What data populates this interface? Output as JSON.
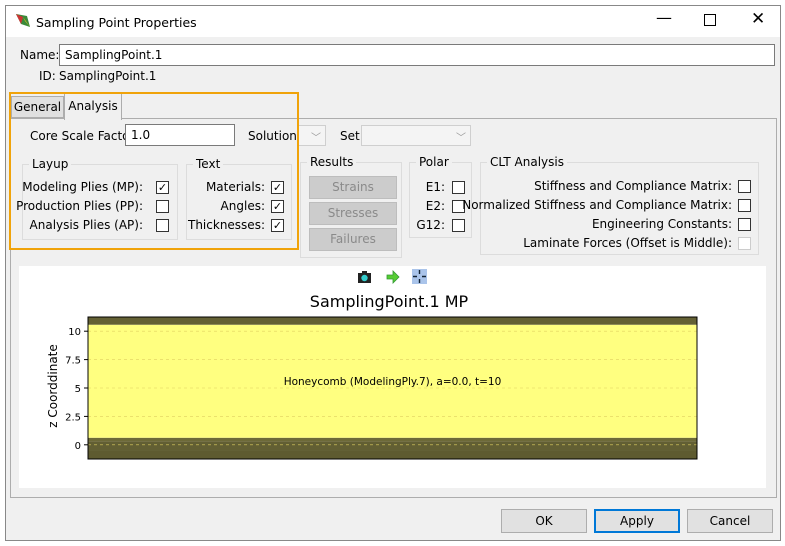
{
  "window": {
    "title": "Sampling Point Properties",
    "controls": [
      "minimize",
      "maximize",
      "close"
    ]
  },
  "name": {
    "label": "Name:",
    "value": "SamplingPoint.1"
  },
  "id": {
    "label": "ID:",
    "value": "SamplingPoint.1"
  },
  "tabs": [
    {
      "label": "General",
      "active": false
    },
    {
      "label": "Analysis",
      "active": true
    }
  ],
  "analysis": {
    "core_scale_factor": {
      "label": "Core Scale Factor:",
      "value": "1.0"
    },
    "solution": {
      "label": "Solution:",
      "value": ""
    },
    "set": {
      "label": "Set:",
      "value": ""
    },
    "layup": {
      "title": "Layup",
      "items": [
        {
          "label": "Modeling Plies (MP):",
          "checked": true
        },
        {
          "label": "Production Plies (PP):",
          "checked": false
        },
        {
          "label": "Analysis Plies (AP):",
          "checked": false
        }
      ]
    },
    "text": {
      "title": "Text",
      "items": [
        {
          "label": "Materials:",
          "checked": true
        },
        {
          "label": "Angles:",
          "checked": true
        },
        {
          "label": "Thicknesses:",
          "checked": true
        }
      ]
    },
    "results": {
      "title": "Results",
      "buttons": [
        "Strains",
        "Stresses",
        "Failures"
      ]
    },
    "polar": {
      "title": "Polar",
      "items": [
        {
          "label": "E1:",
          "checked": false
        },
        {
          "label": "E2:",
          "checked": false
        },
        {
          "label": "G12:",
          "checked": false
        }
      ]
    },
    "clt": {
      "title": "CLT Analysis",
      "items": [
        {
          "label": "Stiffness and Compliance Matrix:",
          "checked": false,
          "enabled": true
        },
        {
          "label": "Normalized Stiffness and Compliance Matrix:",
          "checked": false,
          "enabled": true
        },
        {
          "label": "Engineering Constants:",
          "checked": false,
          "enabled": true
        },
        {
          "label": "Laminate Forces (Offset is Middle):",
          "checked": false,
          "enabled": false
        }
      ]
    }
  },
  "chart_toolbar": [
    "camera-icon",
    "arrow-right-icon",
    "fit-icon"
  ],
  "chart_data": {
    "type": "layup",
    "title": "SamplingPoint.1 MP",
    "ylabel": "z Coorddinate",
    "ylim": [
      -1.25,
      11.25
    ],
    "yticks": [
      "0",
      "2.5",
      "5",
      "7.5",
      "10"
    ],
    "grid": true,
    "layers": [
      {
        "z": [
          -1.25,
          -0.5
        ],
        "color": "#5e5b30"
      },
      {
        "z": [
          -0.5,
          0.3
        ],
        "color": "#625f33"
      },
      {
        "z": [
          0.3,
          0.62
        ],
        "color": "#6d6a38"
      },
      {
        "z": [
          0.62,
          10.57
        ],
        "color": "#ffff80",
        "label": "Honeycomb (ModelingPly.7), a=0.0, t=10"
      },
      {
        "z": [
          10.57,
          11.25
        ],
        "color": "#646134"
      }
    ]
  },
  "buttons": {
    "ok": "OK",
    "apply": "Apply",
    "cancel": "Cancel"
  },
  "colors": {
    "highlight": "#f0a30a",
    "accent": "#0078d7"
  }
}
